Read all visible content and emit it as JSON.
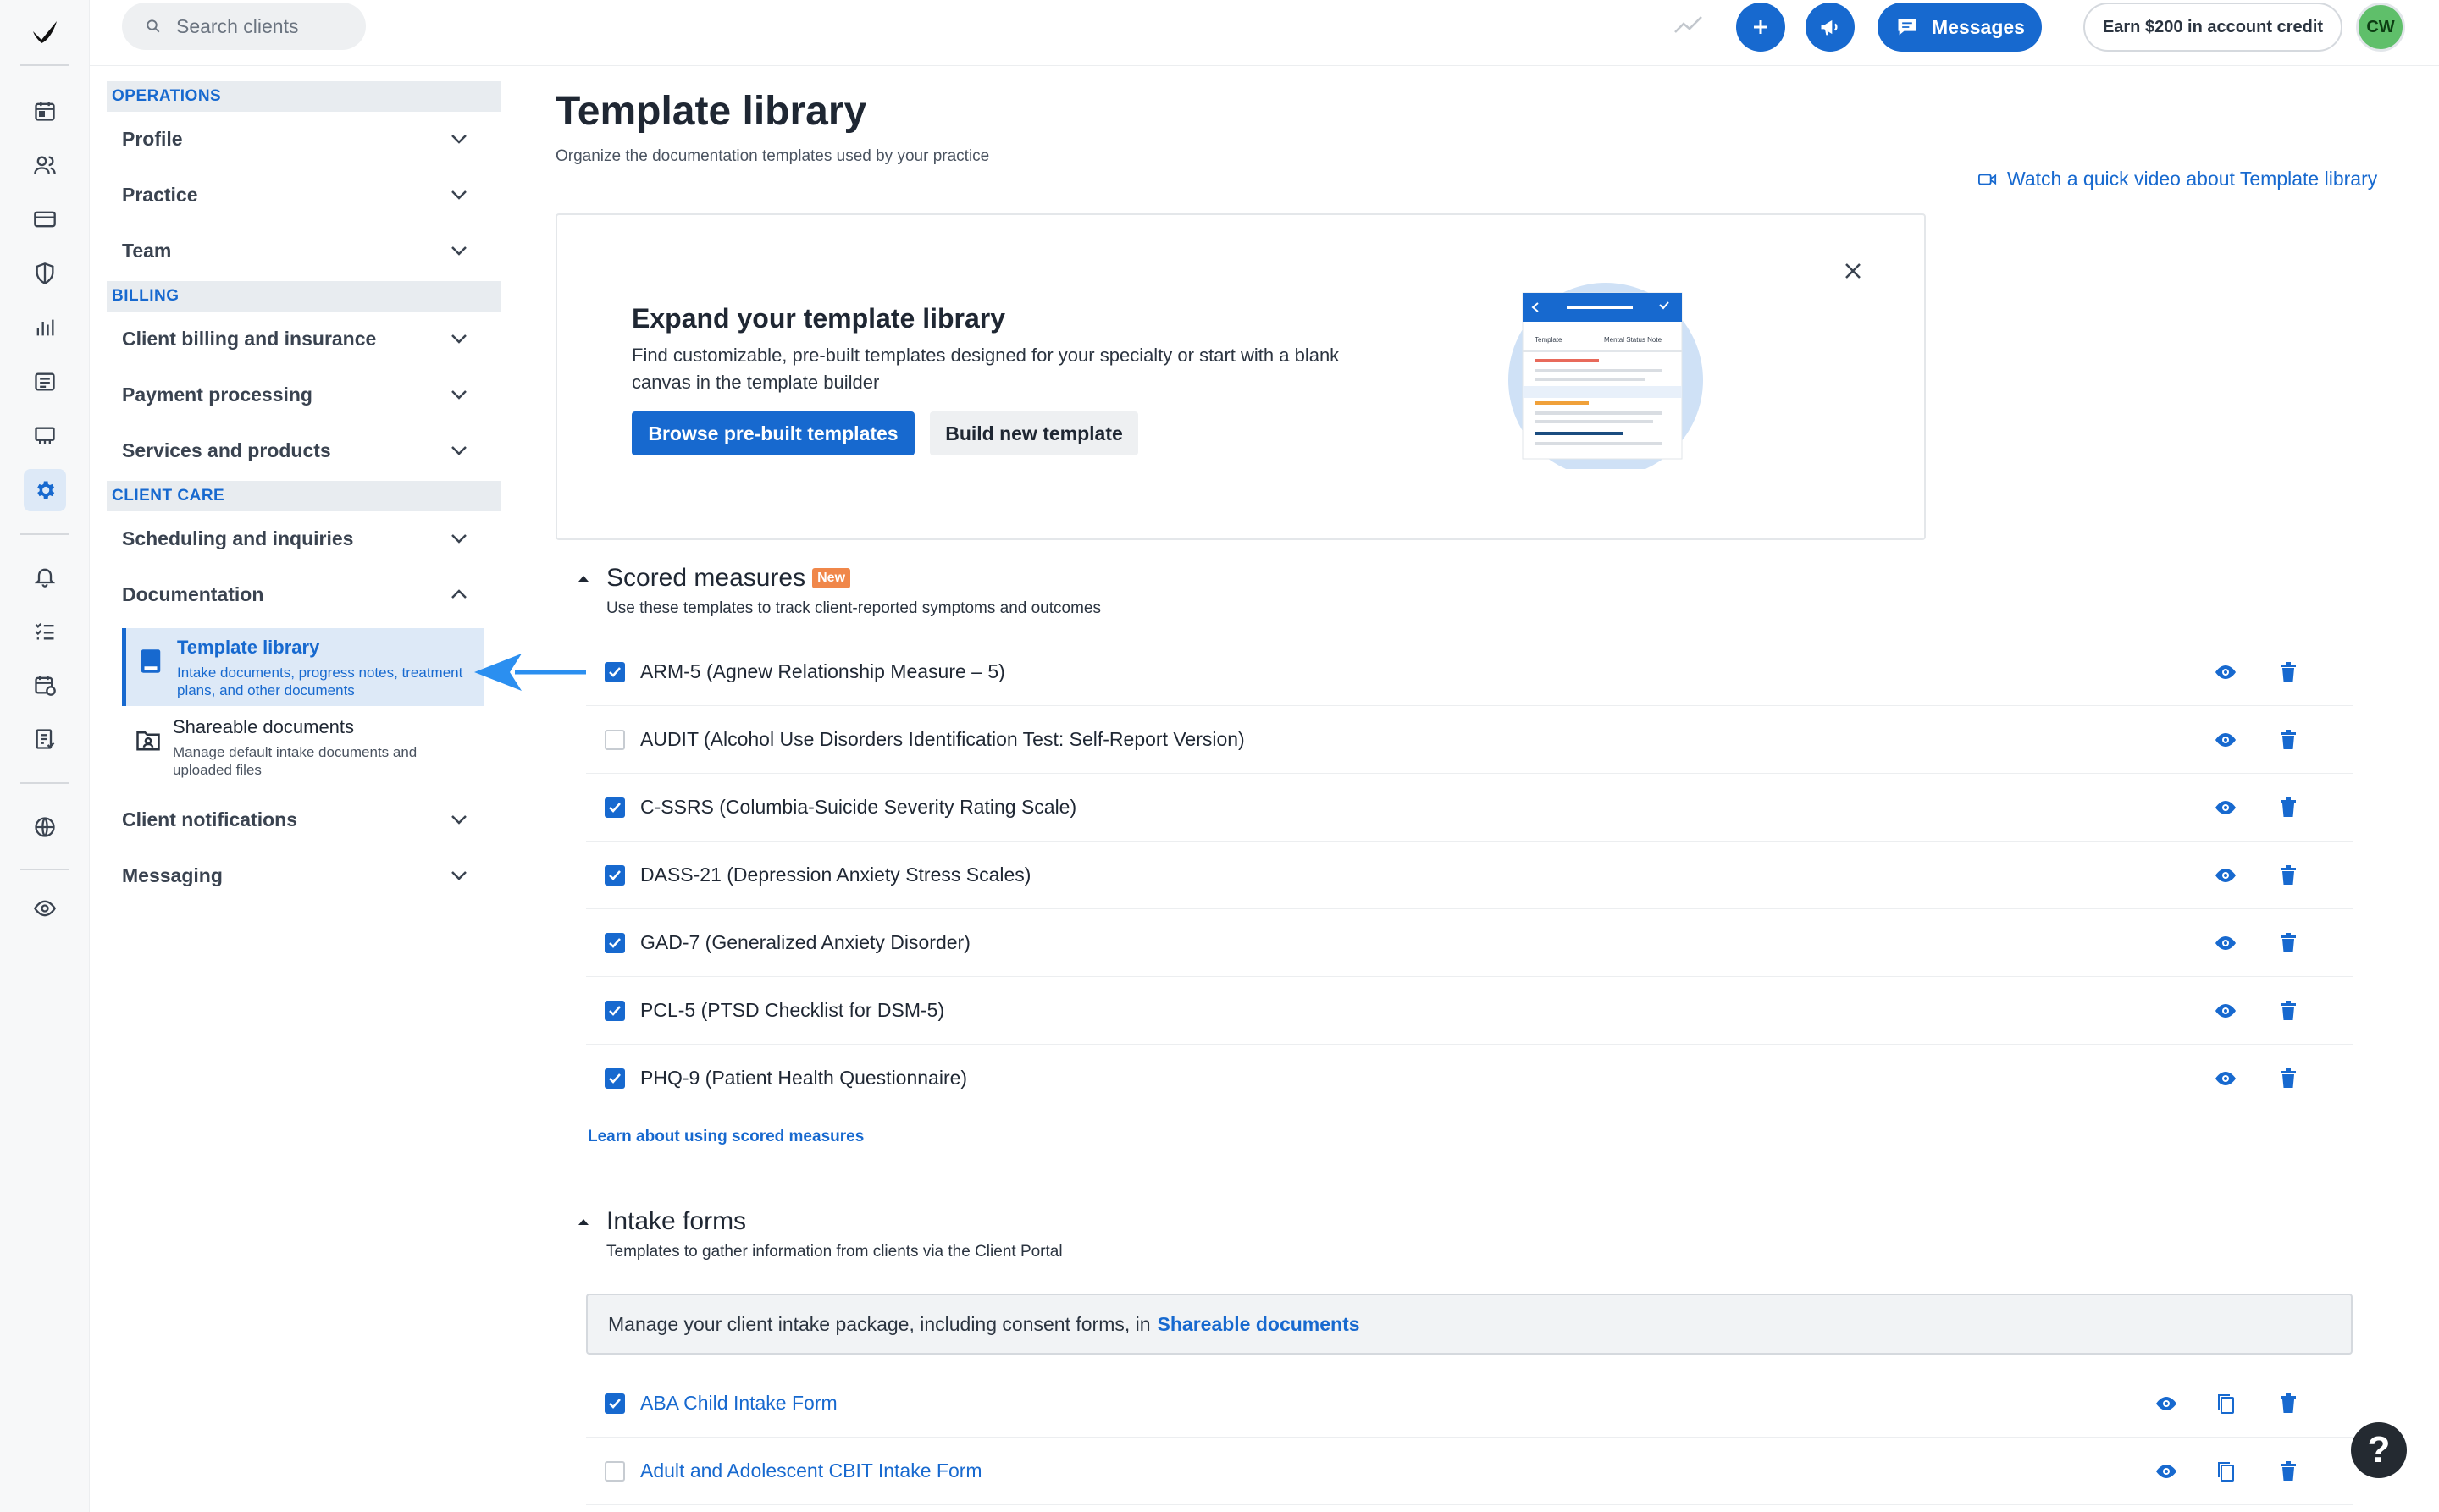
{
  "topbar": {
    "search_placeholder": "Search clients",
    "messages_label": "Messages",
    "earn_label": "Earn $200 in account credit",
    "avatar_initials": "CW"
  },
  "sidebar": {
    "sections": [
      {
        "label": "OPERATIONS"
      },
      {
        "label": "BILLING"
      },
      {
        "label": "CLIENT CARE"
      }
    ],
    "items": {
      "profile": "Profile",
      "practice": "Practice",
      "team": "Team",
      "client_billing": "Client billing and insurance",
      "payment_processing": "Payment processing",
      "services_products": "Services and products",
      "scheduling": "Scheduling and inquiries",
      "documentation": "Documentation",
      "client_notifications": "Client notifications",
      "messaging": "Messaging"
    },
    "subitems": [
      {
        "title": "Template library",
        "desc": "Intake documents, progress notes, treatment plans, and other documents"
      },
      {
        "title": "Shareable documents",
        "desc": "Manage default intake documents and uploaded files"
      }
    ]
  },
  "main": {
    "title": "Template library",
    "subtitle": "Organize the documentation templates used by your practice",
    "video_link": "Watch a quick video about Template library",
    "promo": {
      "title": "Expand your template library",
      "desc": "Find customizable, pre-built templates designed for your specialty or start with a blank canvas in the template builder",
      "browse_button": "Browse pre-built templates",
      "build_button": "Build new template",
      "illus_tab_left": "Template",
      "illus_tab_right": "Mental Status Note"
    },
    "scored": {
      "title": "Scored measures",
      "badge": "New",
      "desc": "Use these templates to track client-reported symptoms and outcomes",
      "rows": [
        {
          "label": "ARM-5 (Agnew Relationship Measure – 5)",
          "checked": true
        },
        {
          "label": "AUDIT (Alcohol Use Disorders Identification Test: Self-Report Version)",
          "checked": false
        },
        {
          "label": "C-SSRS (Columbia-Suicide Severity Rating Scale)",
          "checked": true
        },
        {
          "label": "DASS-21 (Depression Anxiety Stress Scales)",
          "checked": true
        },
        {
          "label": "GAD-7 (Generalized Anxiety Disorder)",
          "checked": true
        },
        {
          "label": "PCL-5 (PTSD Checklist for DSM-5)",
          "checked": true
        },
        {
          "label": "PHQ-9 (Patient Health Questionnaire)",
          "checked": true
        }
      ],
      "learn_link": "Learn about using scored measures"
    },
    "intake": {
      "title": "Intake forms",
      "desc": "Templates to gather information from clients via the Client Portal",
      "banner_text": "Manage your client intake package, including consent forms, in",
      "banner_link": "Shareable documents",
      "rows": [
        {
          "label": "ABA Child Intake Form",
          "checked": true
        },
        {
          "label": "Adult and Adolescent CBIT Intake Form",
          "checked": false
        }
      ]
    }
  },
  "help_label": "?",
  "colors": {
    "accent": "#1769cf",
    "badge": "#f0874a",
    "avatar": "#5fbf6a"
  }
}
